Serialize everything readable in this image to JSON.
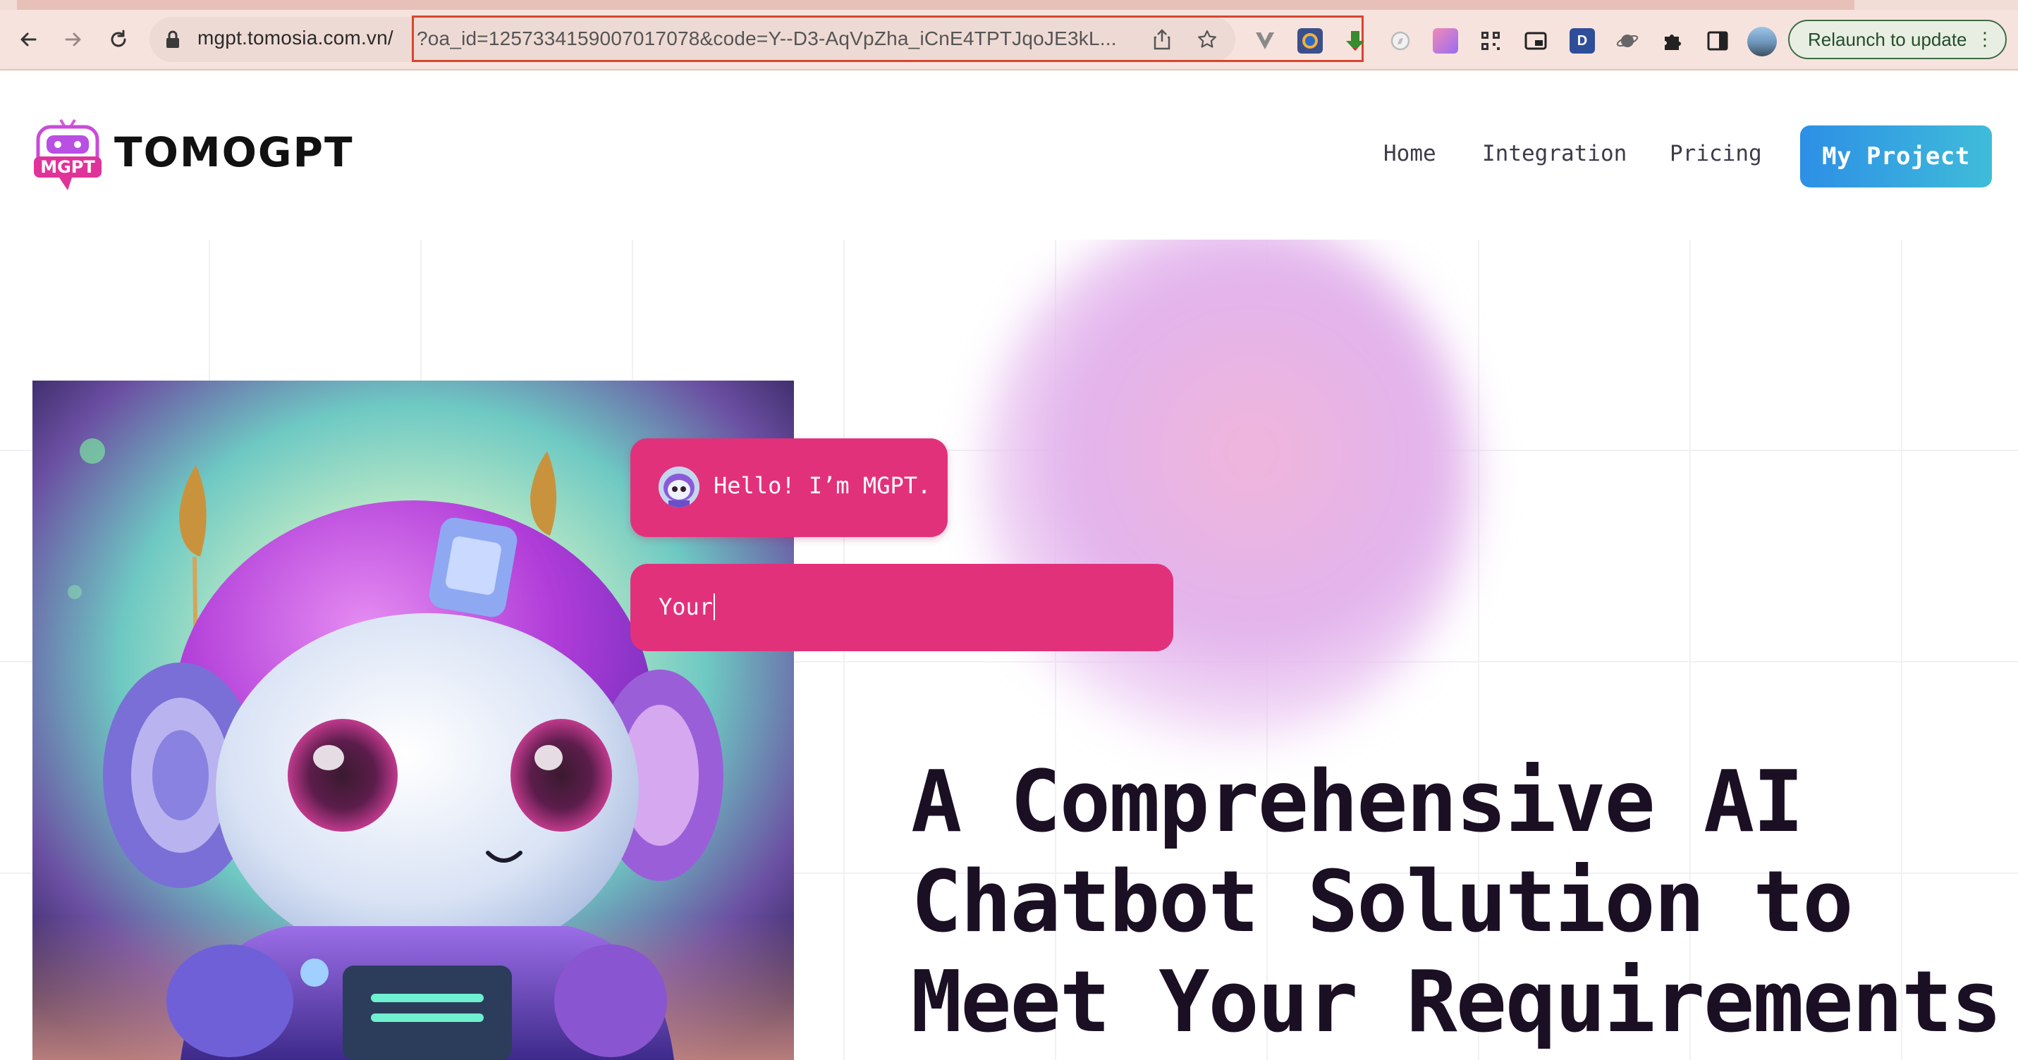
{
  "browser": {
    "url_host": "mgpt.tomosia.com.vn/",
    "url_query": "?oa_id=1257334159007017078&code=Y--D3-AqVpZha_iCnE4TPTJqoJE3kL...",
    "extensions": [
      "vivaldi-v-icon",
      "globe-extension-icon",
      "download-arrow-icon",
      "compass-icon",
      "gradient-extension-icon",
      "qr-code-icon",
      "picture-in-picture-icon",
      "d-extension-icon",
      "planet-icon",
      "puzzle-icon",
      "sidebar-icon",
      "profile-avatar"
    ],
    "d_extension_letter": "D",
    "relaunch_label": "Relaunch to update",
    "relaunch_menu": "⋮"
  },
  "header": {
    "logo_text": "TOMOGPT",
    "logo_badge": "MGPT",
    "nav": {
      "home": "Home",
      "integration": "Integration",
      "pricing": "Pricing"
    },
    "cta_label": "My Project"
  },
  "hero": {
    "chat_greeting": "Hello! I’m MGPT.",
    "chat_input_value": "Your",
    "headline_lines": [
      "A Comprehensive AI",
      "Chatbot Solution to",
      "Meet Your Requirements"
    ]
  },
  "colors": {
    "accent_pink": "#e2317b",
    "cta_gradient_start": "#2d8fe6",
    "cta_gradient_end": "#3fbcd9",
    "headline": "#1b0f24",
    "chrome_bg": "#f7e3dd",
    "url_highlight_border": "#d9452e"
  }
}
